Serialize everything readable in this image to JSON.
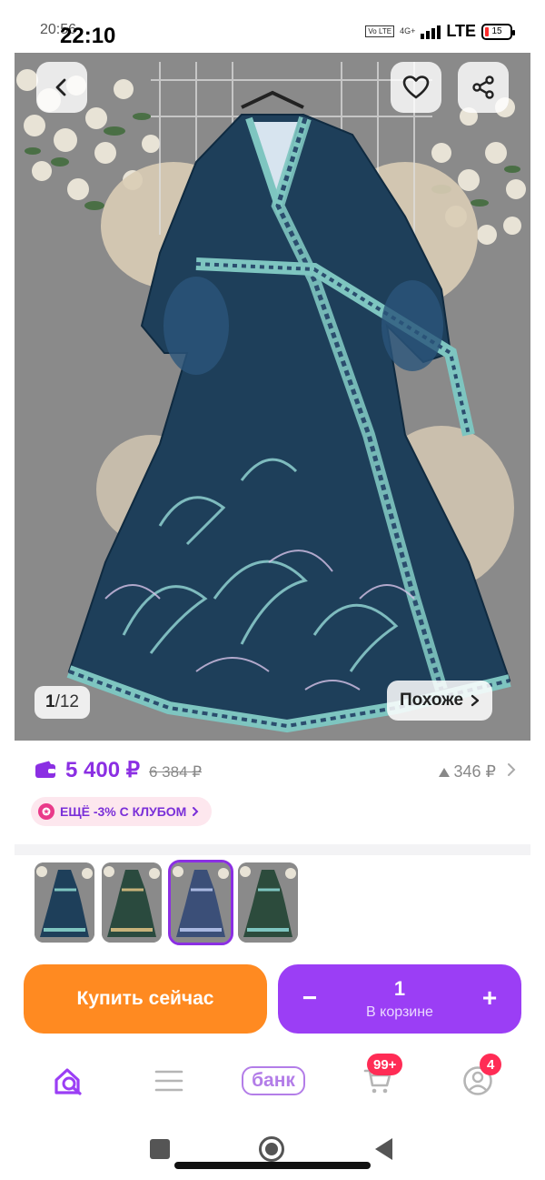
{
  "status_bar": {
    "time_overlay": "20:56",
    "time": "22:10",
    "volte": "Vo LTE",
    "network_gen": "4G+",
    "network_type": "LTE",
    "battery": "15"
  },
  "product_image": {
    "counter_current": "1",
    "counter_separator": "/",
    "counter_total": "12",
    "similar_label": "Похоже",
    "icons": {
      "back": "chevron-left-icon",
      "favorite": "heart-icon",
      "share": "share-icon"
    }
  },
  "price": {
    "current": "5 400 ₽",
    "old": "6 384 ₽",
    "points": "346 ₽",
    "club_offer": "ЕЩЁ -3% С КЛУБОМ",
    "accent_color": "#8b2fe3"
  },
  "thumbnails": {
    "count": 4,
    "selected_index": 2
  },
  "actions": {
    "buy_now": "Купить сейчас",
    "quantity": "1",
    "in_cart": "В корзине",
    "minus": "−",
    "plus": "+"
  },
  "bottom_nav": {
    "bank_label": "банк",
    "cart_badge": "99+",
    "profile_badge": "4"
  },
  "colors": {
    "buy_button": "#ff8a21",
    "cart_button": "#9b3ef5",
    "badge": "#ff2c55"
  }
}
